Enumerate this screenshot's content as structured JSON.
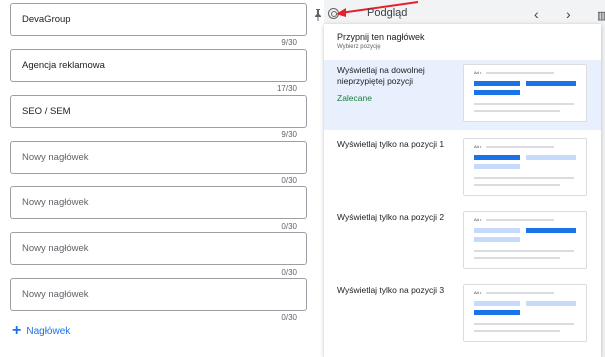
{
  "headlines": [
    {
      "value": "DevaGroup",
      "placeholder": "Nowy nagłówek",
      "counter": "9/30"
    },
    {
      "value": "Agencja reklamowa",
      "placeholder": "Nowy nagłówek",
      "counter": "17/30"
    },
    {
      "value": "SEO / SEM",
      "placeholder": "Nowy nagłówek",
      "counter": "9/30"
    },
    {
      "value": "",
      "placeholder": "Nowy nagłówek",
      "counter": "0/30"
    },
    {
      "value": "",
      "placeholder": "Nowy nagłówek",
      "counter": "0/30"
    },
    {
      "value": "",
      "placeholder": "Nowy nagłówek",
      "counter": "0/30"
    },
    {
      "value": "",
      "placeholder": "Nowy nagłówek",
      "counter": "0/30"
    }
  ],
  "add_headline": {
    "plus": "+",
    "label": "Nagłówek"
  },
  "preview": {
    "title": "Podgląd",
    "prev": "‹",
    "next": "›",
    "side_icon": "▥"
  },
  "pin_menu": {
    "title": "Przypnij ten nagłówek",
    "subtitle": "Wybierz pozycję",
    "options": [
      {
        "label": "Wyświetlaj na dowolnej nieprzypiętej pozycji",
        "recommended": "Zalecane",
        "ad_tag": "Ad •"
      },
      {
        "label": "Wyświetlaj tylko na pozycji 1",
        "ad_tag": "Ad •"
      },
      {
        "label": "Wyświetlaj tylko na pozycji 2",
        "ad_tag": "Ad •"
      },
      {
        "label": "Wyświetlaj tylko na pozycji 3",
        "ad_tag": "Ad •"
      }
    ]
  },
  "colors": {
    "accent": "#1a73e8",
    "light_accent": "#c6dafc",
    "recommended": "#188038",
    "arrow": "#e8202a",
    "selected_bg": "#e8f0fe"
  }
}
